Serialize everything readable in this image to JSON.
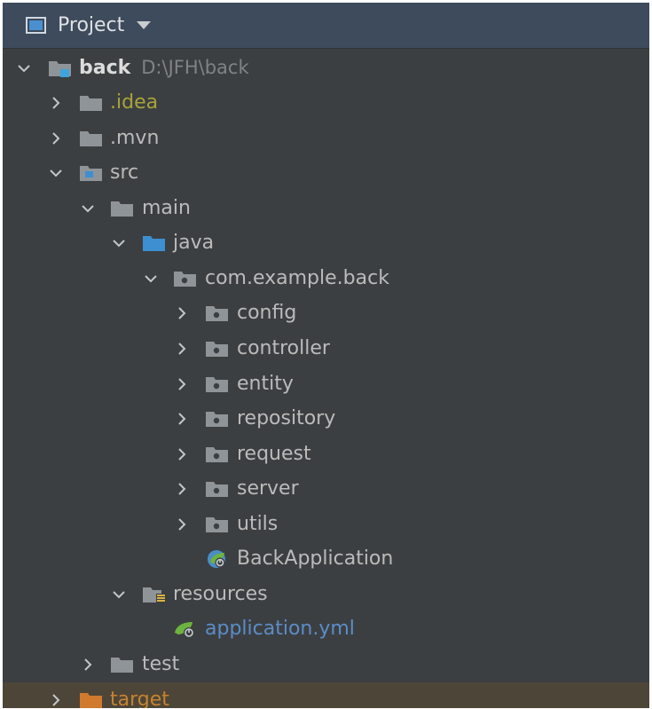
{
  "panel": {
    "title": "Project",
    "icon": "project-window-icon",
    "dropdown_icon": "dropdown-caret-icon"
  },
  "colors": {
    "panel_bg": "#3c3f41",
    "header_bg": "#3d4b5c",
    "text": "#bbbbbb",
    "excluded_text": "#a9a33a",
    "yml_text": "#5c8cc8",
    "target_text": "#c6822e",
    "target_row_bg": "#4d4638",
    "folder_gray": "#8f9499",
    "source_folder_blue": "#3d8fd1",
    "target_folder_orange": "#d07a2e"
  },
  "tree": {
    "root": {
      "name": "back",
      "path": "D:\\JFH\\back",
      "expanded": true,
      "icon": "module-folder-icon"
    },
    "idea": {
      "name": ".idea",
      "expanded": false,
      "icon": "folder-icon"
    },
    "mvn": {
      "name": ".mvn",
      "expanded": false,
      "icon": "folder-icon"
    },
    "src": {
      "name": "src",
      "expanded": true,
      "icon": "source-root-folder-icon"
    },
    "main": {
      "name": "main",
      "expanded": true,
      "icon": "folder-icon"
    },
    "java": {
      "name": "java",
      "expanded": true,
      "icon": "java-source-folder-icon"
    },
    "package": {
      "name": "com.example.back",
      "expanded": true,
      "icon": "package-icon"
    },
    "packages": [
      {
        "name": "config",
        "expanded": false,
        "icon": "package-icon"
      },
      {
        "name": "controller",
        "expanded": false,
        "icon": "package-icon"
      },
      {
        "name": "entity",
        "expanded": false,
        "icon": "package-icon"
      },
      {
        "name": "repository",
        "expanded": false,
        "icon": "package-icon"
      },
      {
        "name": "request",
        "expanded": false,
        "icon": "package-icon"
      },
      {
        "name": "server",
        "expanded": false,
        "icon": "package-icon"
      },
      {
        "name": "utils",
        "expanded": false,
        "icon": "package-icon"
      }
    ],
    "app_class": {
      "name": "BackApplication",
      "icon": "spring-boot-class-icon"
    },
    "resources": {
      "name": "resources",
      "expanded": true,
      "icon": "resources-folder-icon"
    },
    "yml": {
      "name": "application.yml",
      "icon": "spring-config-file-icon"
    },
    "test": {
      "name": "test",
      "expanded": false,
      "icon": "folder-icon"
    },
    "target": {
      "name": "target",
      "expanded": false,
      "icon": "excluded-folder-icon"
    }
  }
}
